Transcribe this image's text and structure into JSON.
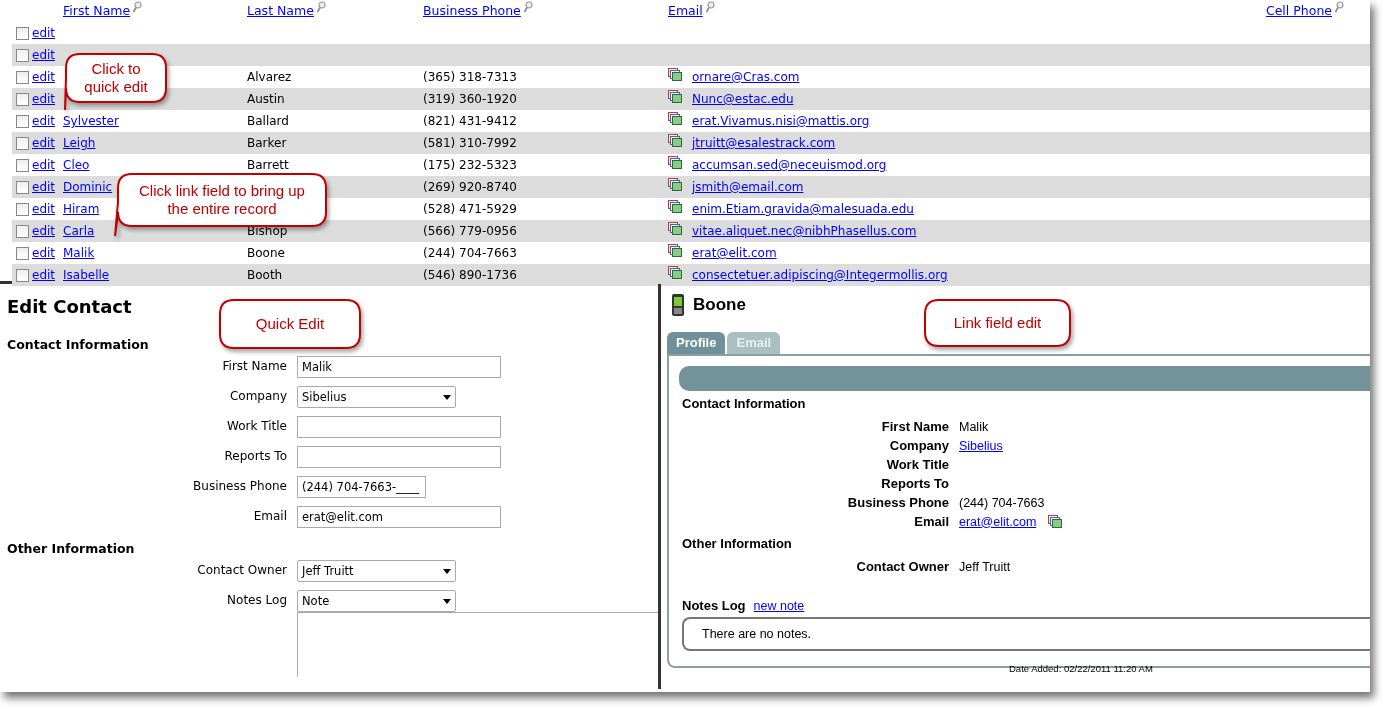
{
  "grid": {
    "columns": [
      {
        "label": "First Name"
      },
      {
        "label": "Last Name"
      },
      {
        "label": "Business Phone"
      },
      {
        "label": "Email"
      },
      {
        "label": "Cell Phone"
      }
    ],
    "rows": [
      {
        "checked": false,
        "edit": "edit"
      },
      {
        "checked": false,
        "edit": "edit"
      },
      {
        "checked": false,
        "edit": "edit",
        "last_name": "Alvarez",
        "phone": "(365) 318-7313",
        "email": "ornare@Cras.com"
      },
      {
        "checked": false,
        "edit": "edit",
        "last_name": "Austin",
        "phone": "(319) 360-1920",
        "email": "Nunc@estac.edu"
      },
      {
        "checked": false,
        "edit": "edit",
        "first_name": "Sylvester",
        "last_name": "Ballard",
        "phone": "(821) 431-9412",
        "email": "erat.Vivamus.nisi@mattis.org"
      },
      {
        "checked": false,
        "edit": "edit",
        "first_name": "Leigh",
        "last_name": "Barker",
        "phone": "(581) 310-7992",
        "email": "jtruitt@esalestrack.com"
      },
      {
        "checked": false,
        "edit": "edit",
        "first_name": "Cleo",
        "last_name": "Barrett",
        "phone": "(175) 232-5323",
        "email": "accumsan.sed@neceuismod.org"
      },
      {
        "checked": false,
        "edit": "edit",
        "first_name": "Dominic",
        "phone": "(269) 920-8740",
        "email": "jsmith@email.com"
      },
      {
        "checked": false,
        "edit": "edit",
        "first_name": "Hiram",
        "phone": "(528) 471-5929",
        "email": "enim.Etiam.gravida@malesuada.edu"
      },
      {
        "checked": false,
        "edit": "edit",
        "first_name": "Carla",
        "last_name": "Bishop",
        "phone": "(566) 779-0956",
        "email": "vitae.aliquet.nec@nibhPhasellus.com"
      },
      {
        "checked": false,
        "edit": "edit",
        "first_name": "Malik",
        "last_name": "Boone",
        "phone": "(244) 704-7663",
        "email": "erat@elit.com"
      },
      {
        "checked": false,
        "edit": "edit",
        "first_name": "Isabelle",
        "last_name": "Booth",
        "phone": "(546) 890-1736",
        "email": "consectetuer.adipiscing@Integermollis.org"
      }
    ]
  },
  "quick_edit": {
    "title": "Edit Contact",
    "sections": [
      {
        "heading": "Contact Information",
        "fields": [
          {
            "kind": "text",
            "label": "First Name",
            "value": "Malik"
          },
          {
            "kind": "select",
            "label": "Company",
            "value": "Sibelius"
          },
          {
            "kind": "text",
            "label": "Work Title"
          },
          {
            "kind": "text",
            "label": "Reports To"
          },
          {
            "kind": "phone",
            "label": "Business Phone",
            "value": "(244) 704-7663-____"
          },
          {
            "kind": "text",
            "label": "Email",
            "value": "erat@elit.com"
          }
        ]
      },
      {
        "heading": "Other Information",
        "fields": [
          {
            "kind": "select",
            "label": "Contact Owner",
            "value": "Jeff Truitt"
          },
          {
            "kind": "select",
            "label": "Notes Log",
            "value": "Note"
          },
          {
            "kind": "textarea"
          }
        ]
      }
    ]
  },
  "record": {
    "title": "Boone",
    "tabs": [
      {
        "label": "Profile",
        "selected": true
      },
      {
        "label": "Email",
        "selected": false
      }
    ],
    "sections": [
      {
        "heading": "Contact Information",
        "fields": [
          {
            "kind": "text",
            "label": "First Name",
            "value": "Malik"
          },
          {
            "kind": "link",
            "label": "Company",
            "value": "Sibelius"
          },
          {
            "kind": "text",
            "label": "Work Title"
          },
          {
            "kind": "text",
            "label": "Reports To"
          },
          {
            "kind": "text",
            "label": "Business Phone",
            "value": "(244) 704-7663"
          },
          {
            "kind": "email",
            "label": "Email",
            "value": "erat@elit.com"
          }
        ]
      },
      {
        "heading": "Other Information",
        "fields": [
          {
            "kind": "text",
            "label": "Contact Owner",
            "value": "Jeff Truitt"
          }
        ]
      }
    ],
    "notes_log": {
      "label": "Notes Log",
      "link": "new note",
      "empty": "There are no notes."
    },
    "date_added": "Date Added: 02/22/2011 11:20 AM"
  },
  "callouts": [
    {
      "text": "Click to quick edit"
    },
    {
      "text": "Click link field to bring up the entire record"
    },
    {
      "text": "Quick Edit"
    },
    {
      "text": "Link field edit"
    }
  ]
}
